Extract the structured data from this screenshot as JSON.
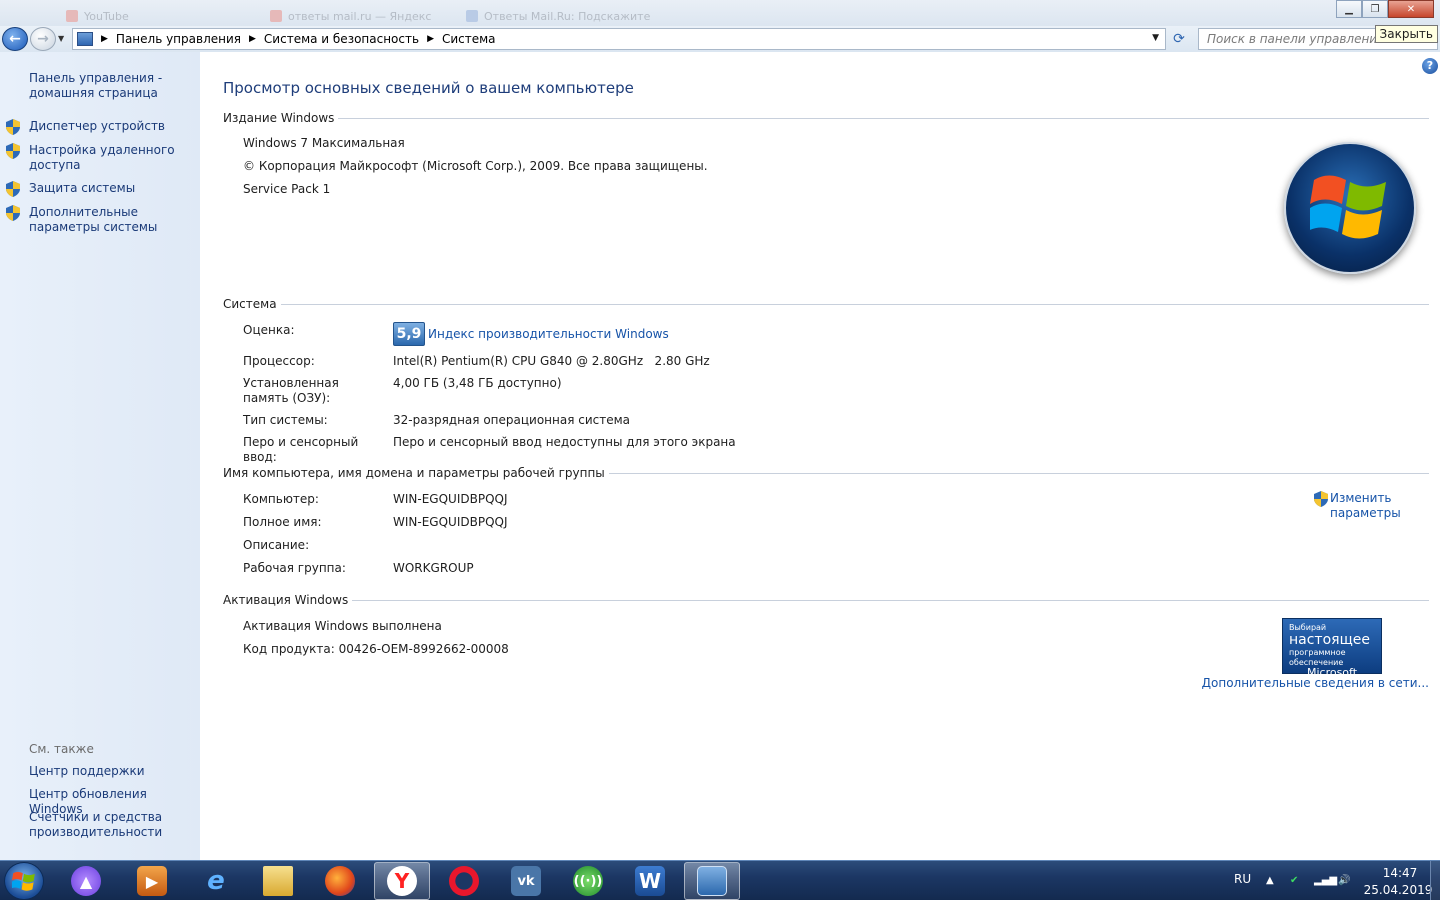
{
  "window": {
    "ghost_tabs": [
      "YouTube",
      "ответы mail.ru — Яндекс",
      "Ответы Mail.Ru: Подскажите"
    ],
    "tooltip": "Закрыть"
  },
  "address": {
    "breadcrumbs": [
      "Панель управления",
      "Система и безопасность",
      "Система"
    ],
    "search_placeholder": "Поиск в панели управления"
  },
  "sidebar": {
    "home": "Панель управления - домашняя страница",
    "items": [
      {
        "label": "Диспетчер устройств"
      },
      {
        "label": "Настройка удаленного доступа"
      },
      {
        "label": "Защита системы"
      },
      {
        "label": "Дополнительные параметры системы"
      }
    ],
    "see_also_title": "См. также",
    "see_also": [
      "Центр поддержки",
      "Центр обновления Windows",
      "Счетчики и средства производительности"
    ]
  },
  "main": {
    "title": "Просмотр основных сведений о вашем компьютере",
    "edition": {
      "heading": "Издание Windows",
      "name": "Windows 7 Максимальная",
      "copyright": "© Корпорация Майкрософт (Microsoft Corp.), 2009. Все права защищены.",
      "service_pack": "Service Pack 1"
    },
    "system": {
      "heading": "Система",
      "rating_label": "Оценка:",
      "rating_score": "5,9",
      "rating_link": "Индекс производительности Windows",
      "cpu_label": "Процессор:",
      "cpu_value": "Intel(R) Pentium(R) CPU G840 @ 2.80GHz   2.80 GHz",
      "ram_label": "Установленная память (ОЗУ):",
      "ram_value": "4,00 ГБ (3,48 ГБ доступно)",
      "type_label": "Тип системы:",
      "type_value": "32-разрядная операционная система",
      "pen_label": "Перо и сенсорный ввод:",
      "pen_value": "Перо и сенсорный ввод недоступны для этого экрана"
    },
    "computer": {
      "heading": "Имя компьютера, имя домена и параметры рабочей группы",
      "name_label": "Компьютер:",
      "name_value": "WIN-EGQUIDBPQQJ",
      "full_label": "Полное имя:",
      "full_value": "WIN-EGQUIDBPQQJ",
      "desc_label": "Описание:",
      "desc_value": "",
      "group_label": "Рабочая группа:",
      "group_value": "WORKGROUP",
      "change_link": "Изменить параметры"
    },
    "activation": {
      "heading": "Активация Windows",
      "status": "Активация Windows выполнена",
      "product_key": "Код продукта:  00426-OEM-8992662-00008",
      "badge_line1": "Выбирай",
      "badge_line2": "настоящее",
      "badge_line3": "программное обеспечение",
      "badge_line4": "Microsoft",
      "more_info": "Дополнительные сведения в сети..."
    }
  },
  "taskbar": {
    "apps": [
      "alice-icon",
      "media-player-icon",
      "internet-explorer-icon",
      "file-explorer-icon",
      "firefox-icon",
      "yandex-browser-icon",
      "opera-icon",
      "vk-icon",
      "network-app-icon",
      "word-icon",
      "control-panel-icon"
    ],
    "lang": "RU",
    "time": "14:47",
    "date": "25.04.2019"
  }
}
